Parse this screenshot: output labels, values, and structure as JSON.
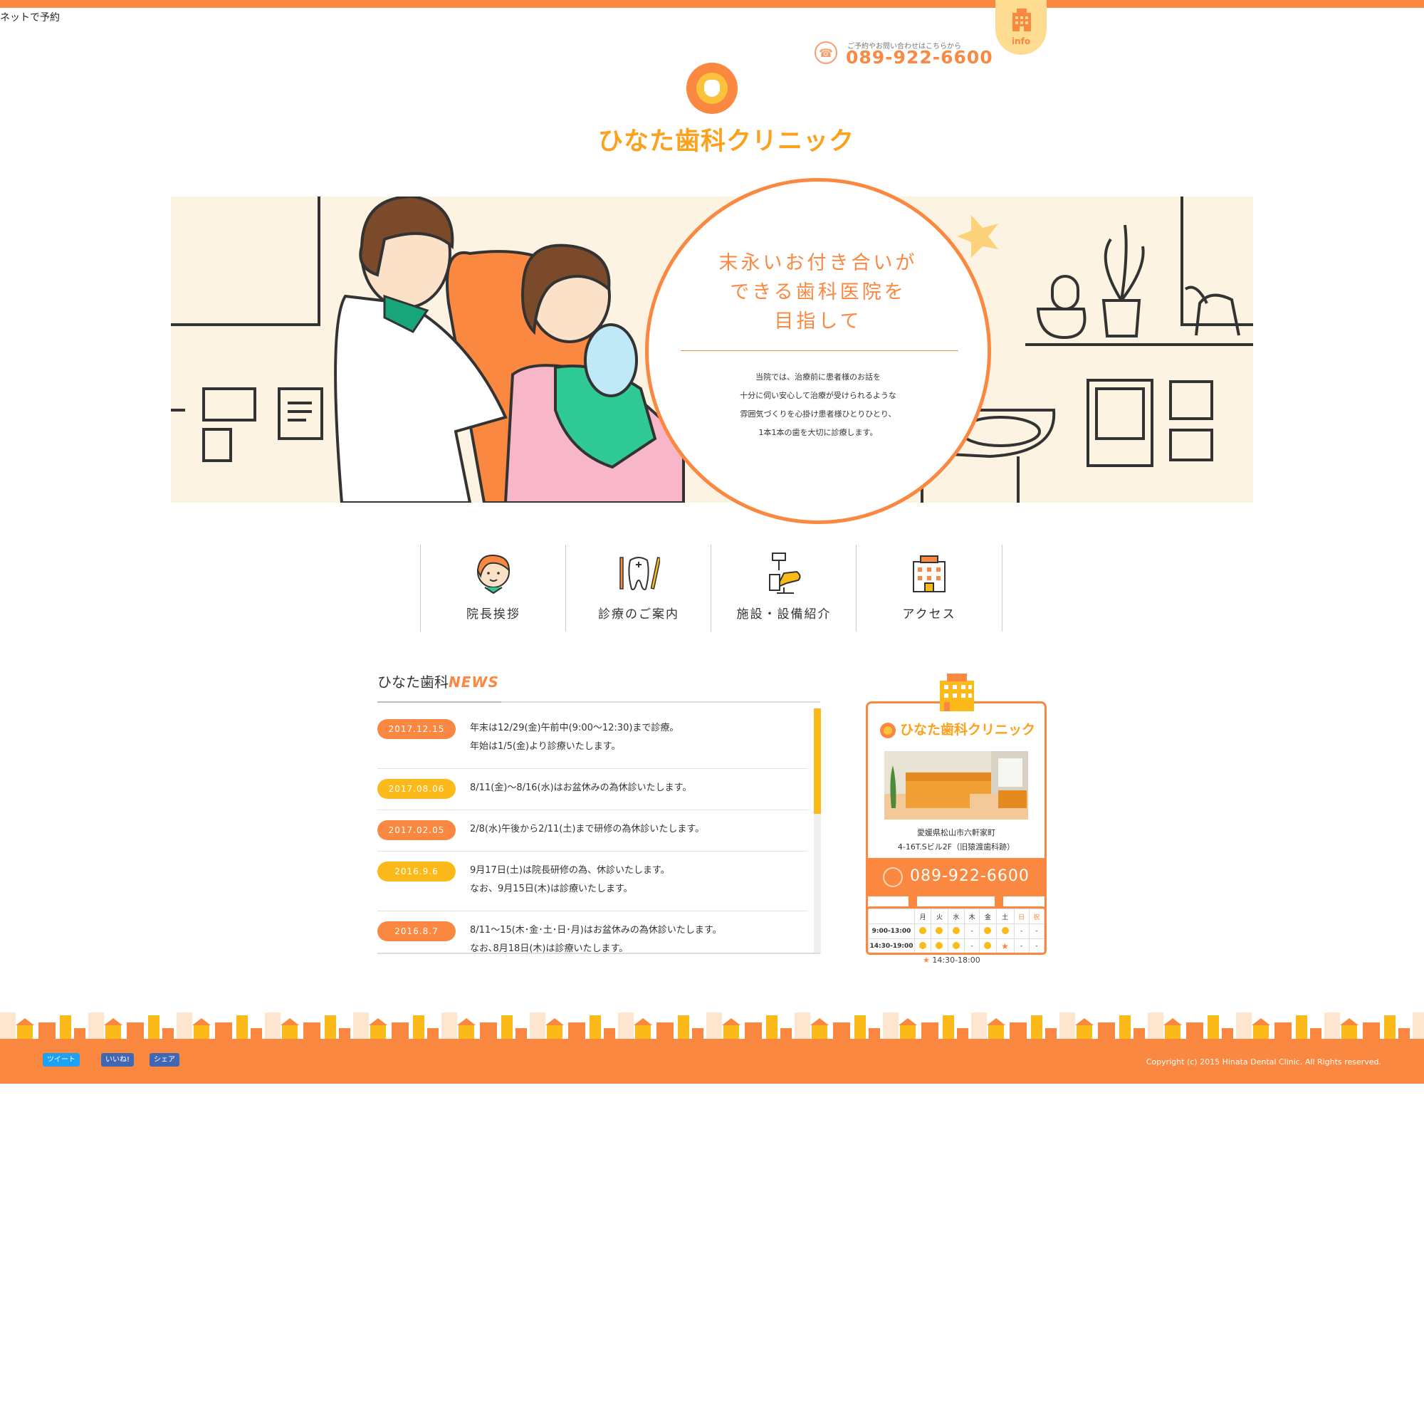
{
  "header": {
    "reservation_link": "ネットで予約",
    "info_tab": "info",
    "tel_caption": "ご予約やお問い合わせはこちらから",
    "tel_number": "089-922-6600",
    "logo_text": "ひなた歯科クリニック"
  },
  "hero": {
    "catch_lines": [
      "末永いお付き合いが",
      "できる歯科医院を",
      "目指して"
    ],
    "description_lines": [
      "当院では、治療前に患者様のお話を",
      "十分に伺い安心して治療が受けられるような",
      "雰囲気づくりを心掛け患者様ひとりひとり、",
      "1本1本の歯を大切に診療します。"
    ]
  },
  "nav": [
    {
      "label": "院長挨拶",
      "icon": "doctor-face-icon"
    },
    {
      "label": "診療のご案内",
      "icon": "tooth-tools-icon"
    },
    {
      "label": "施設・設備紹介",
      "icon": "dental-chair-icon"
    },
    {
      "label": "アクセス",
      "icon": "building-icon"
    }
  ],
  "news": {
    "title_jp": "ひなた歯科",
    "title_en": "NEWS",
    "items": [
      {
        "date": "2017.12.15",
        "color": "#fb8841",
        "lines": [
          "年末は12/29(金)午前中(9:00〜12:30)まで診療。",
          "年始は1/5(金)より診療いたします。"
        ]
      },
      {
        "date": "2017.08.06",
        "color": "#fcb91a",
        "lines": [
          "8/11(金)〜8/16(水)はお盆休みの為休診いたします。"
        ]
      },
      {
        "date": "2017.02.05",
        "color": "#fb8841",
        "lines": [
          "2/8(水)午後から2/11(土)まで研修の為休診いたします。"
        ]
      },
      {
        "date": "2016.9.6",
        "color": "#fcb91a",
        "lines": [
          "9月17日(土)は院長研修の為、休診いたします。",
          "なお、9月15日(木)は診療いたします。"
        ]
      },
      {
        "date": "2016.8.7",
        "color": "#fb8841",
        "lines": [
          "8/11〜15(木･金･土･日･月)はお盆休みの為休診いたします。",
          "なお､8月18日(木)は診療いたします。"
        ]
      }
    ]
  },
  "info_card": {
    "logo_text": "ひなた歯科クリニック",
    "address_lines": [
      "愛媛県松山市六軒家町",
      "4-16T.Sビル2F（旧猿渡歯科跡）"
    ],
    "tel": "089-922-6600",
    "schedule": {
      "days": [
        "月",
        "火",
        "水",
        "木",
        "金",
        "土",
        "日",
        "祝"
      ],
      "rows": [
        {
          "time": "9:00-13:00",
          "marks": [
            "o",
            "o",
            "o",
            "-",
            "o",
            "o",
            "-",
            "-"
          ]
        },
        {
          "time": "14:30-19:00",
          "marks": [
            "o",
            "o",
            "o",
            "-",
            "o",
            "★",
            "-",
            "-"
          ]
        }
      ],
      "note": "14:30-18:00"
    }
  },
  "footer": {
    "tweet": "ツイート",
    "like": "いいね!",
    "share": "シェア",
    "copyright": "Copyright (c) 2015 Hinata Dental Clinic. All Rights reserved."
  },
  "colors": {
    "accent": "#fb8841",
    "yellow": "#fcb91a",
    "cream": "#fdf3e2"
  }
}
